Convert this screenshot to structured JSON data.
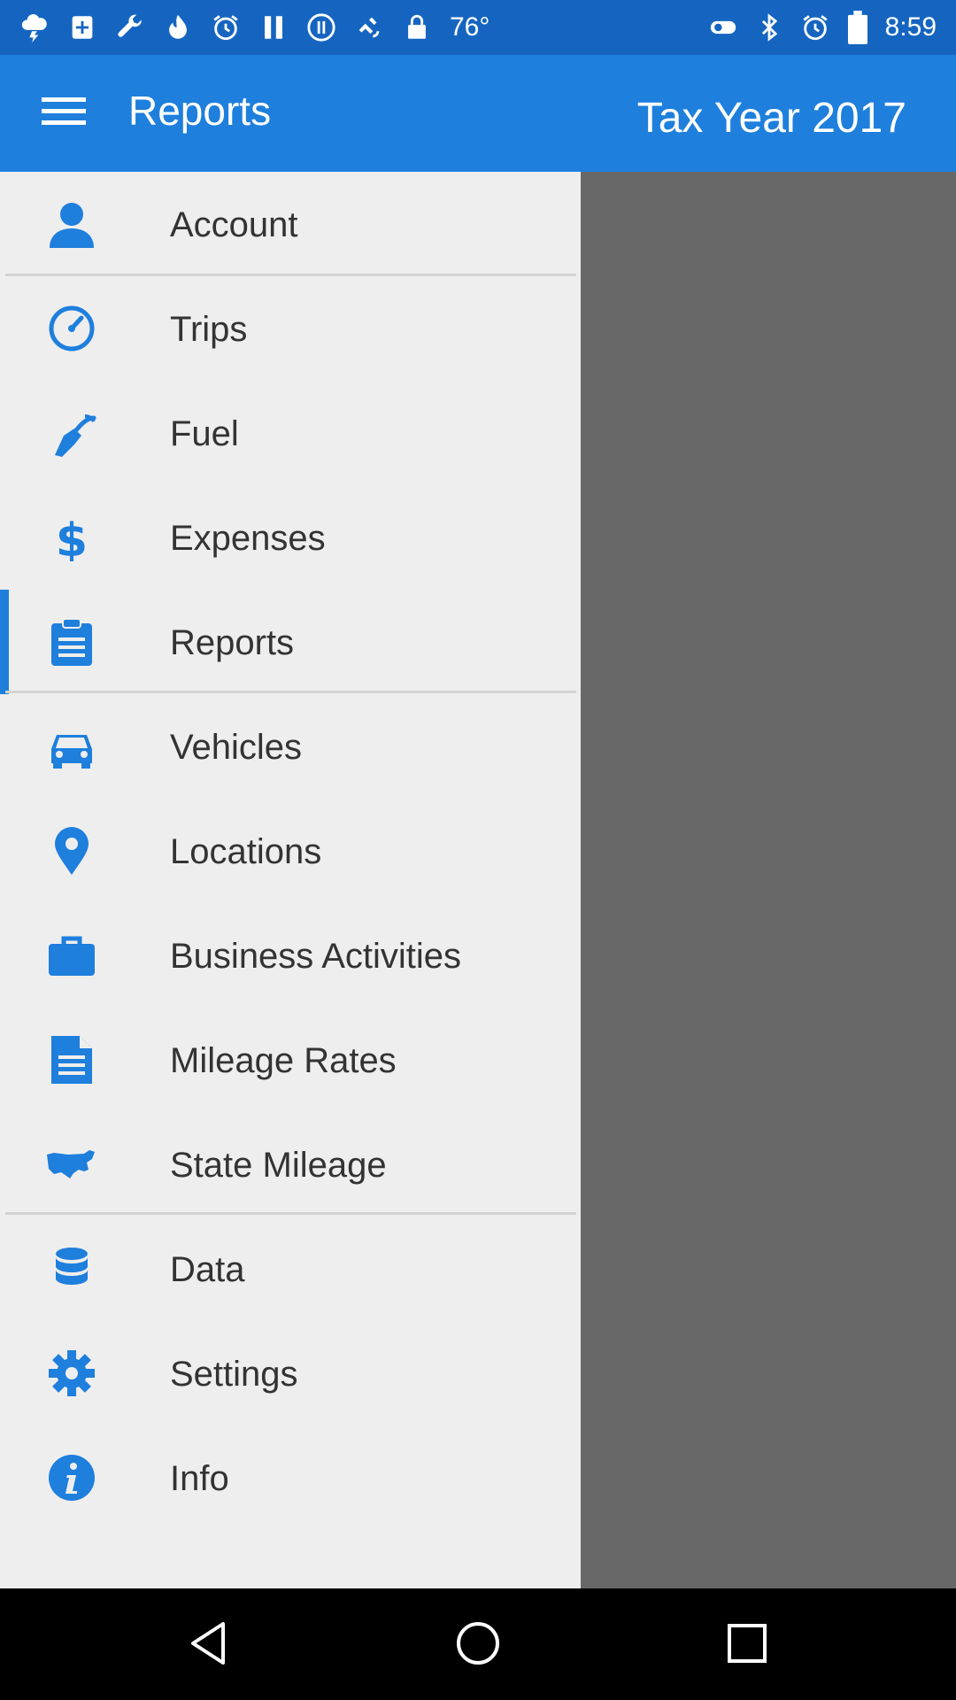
{
  "status_bar": {
    "temperature": "76°",
    "time": "8:59",
    "left_icons": [
      "weather-icon",
      "medical-icon",
      "wrench-icon",
      "flame-icon",
      "alarm-icon",
      "pause-icon",
      "pause-circle-icon",
      "fake-gps-icon",
      "lock-icon"
    ],
    "right_icons": [
      "toggle-icon",
      "bluetooth-icon",
      "alarm-icon",
      "battery-icon"
    ]
  },
  "app_bar": {
    "title": "Reports",
    "tax_year": "Tax Year 2017",
    "background": "#1e7fdd"
  },
  "drawer": {
    "accent_color": "#1e7fdd",
    "selected": "Reports",
    "items": [
      {
        "label": "Account",
        "icon": "person-icon"
      },
      {
        "label": "Trips",
        "icon": "speedometer-icon"
      },
      {
        "label": "Fuel",
        "icon": "fuel-nozzle-icon"
      },
      {
        "label": "Expenses",
        "icon": "dollar-icon"
      },
      {
        "label": "Reports",
        "icon": "clipboard-icon"
      },
      {
        "label": "Vehicles",
        "icon": "car-icon"
      },
      {
        "label": "Locations",
        "icon": "map-pin-icon"
      },
      {
        "label": "Business Activities",
        "icon": "briefcase-icon"
      },
      {
        "label": "Mileage Rates",
        "icon": "document-icon"
      },
      {
        "label": "State Mileage",
        "icon": "usa-map-icon"
      },
      {
        "label": "Data",
        "icon": "database-icon"
      },
      {
        "label": "Settings",
        "icon": "gear-icon"
      },
      {
        "label": "Info",
        "icon": "info-icon"
      }
    ]
  },
  "nav_bar": {
    "buttons": [
      "back-icon",
      "home-icon",
      "recents-icon"
    ]
  }
}
